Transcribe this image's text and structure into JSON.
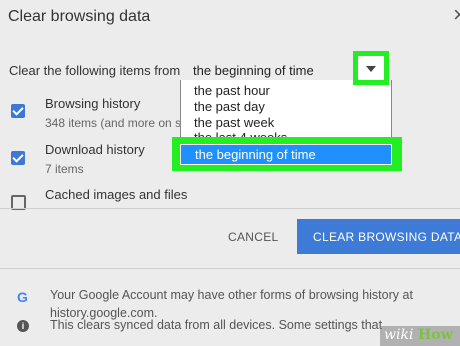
{
  "dialog": {
    "title": "Clear browsing data",
    "close_icon": "×"
  },
  "range": {
    "label": "Clear the following items from",
    "selected_value": "the beginning of time",
    "options": [
      "the past hour",
      "the past day",
      "the past week",
      "the last 4 weeks",
      "the beginning of time"
    ]
  },
  "items": [
    {
      "title": "Browsing history",
      "subtitle": "348 items (and more on s",
      "checked": true
    },
    {
      "title": "Download history",
      "subtitle": "7 items",
      "checked": true
    },
    {
      "title": "Cached images and files",
      "subtitle": "",
      "checked": false
    }
  ],
  "buttons": {
    "cancel": "CANCEL",
    "clear": "CLEAR BROWSING DATA"
  },
  "footer": {
    "google_icon": "G",
    "line1": "Your Google Account may have other forms of browsing history at",
    "line2": "history.google.com.",
    "info_icon": "i",
    "line3": "This clears synced data from all devices. Some settings that"
  },
  "watermark": {
    "part1": "wiki",
    "part2": "How"
  },
  "colors": {
    "highlight": "#22ee22",
    "accent": "#3d7bd6",
    "selection": "#1e90ff"
  }
}
